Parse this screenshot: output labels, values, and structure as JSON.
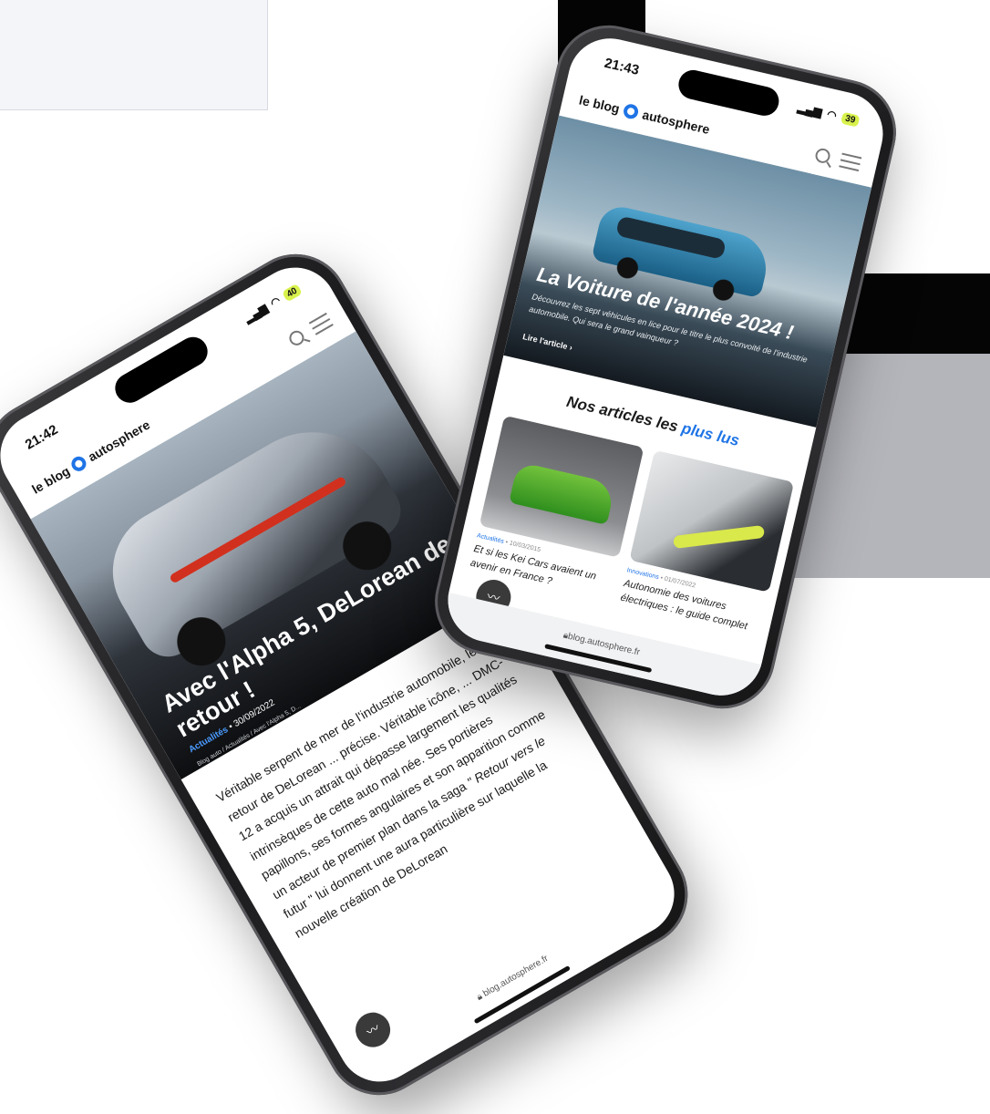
{
  "colors": {
    "accent": "#1f74e6",
    "battery": "#d9f24c",
    "dark": "#050505",
    "gray": "#b4b5bb"
  },
  "phone_left": {
    "status": {
      "time": "21:42",
      "battery": "40"
    },
    "header": {
      "logo_prefix": "le blog",
      "logo_brand": "autosphere"
    },
    "hero": {
      "title": "Avec l'Alpha 5, DeLorean de retour !",
      "category": "Actualités",
      "date": "30/09/2022",
      "breadcrumb": "Blog auto / Actualités / Avec l'Alpha 5, D..."
    },
    "body_text": "Véritable serpent de mer de l'industrie automobile, le retour de DeLorean ... précise. Véritable icône, ... DMC-12 a acquis un attrait qui dépasse largement les qualités intrinsèques de cette auto mal née. Ses portières papillons, ses formes angulaires et son apparition comme un acteur de premier plan dans la saga",
    "body_quote": "\" Retour vers le",
    "body_text_2": "futur \" lui donnent une aura particulière sur laquelle la nouvelle création de DeLorean",
    "url": "blog.autosphere.fr",
    "fab_icon": "wave-icon"
  },
  "phone_right": {
    "status": {
      "time": "21:43",
      "battery": "39"
    },
    "header": {
      "logo_prefix": "le blog",
      "logo_brand": "autosphere"
    },
    "hero": {
      "title": "La Voiture de l'année 2024 !",
      "description": "Découvrez les sept véhicules en lice pour le titre le plus convoité de l'industrie automobile. Qui sera le grand vainqueur ?",
      "link": "Lire l'article"
    },
    "section_title_prefix": "Nos articles les",
    "section_title_highlight": "plus lus",
    "cards": [
      {
        "category": "Actualités",
        "date": "10/03/2015",
        "title": "Et si les Kei Cars avaient un avenir en France ?"
      },
      {
        "category": "Innovations",
        "date": "01/07/2022",
        "title": "Autonomie des voitures électriques : le guide complet"
      }
    ],
    "url": "blog.autosphere.fr",
    "fab_icon": "wave-icon"
  }
}
